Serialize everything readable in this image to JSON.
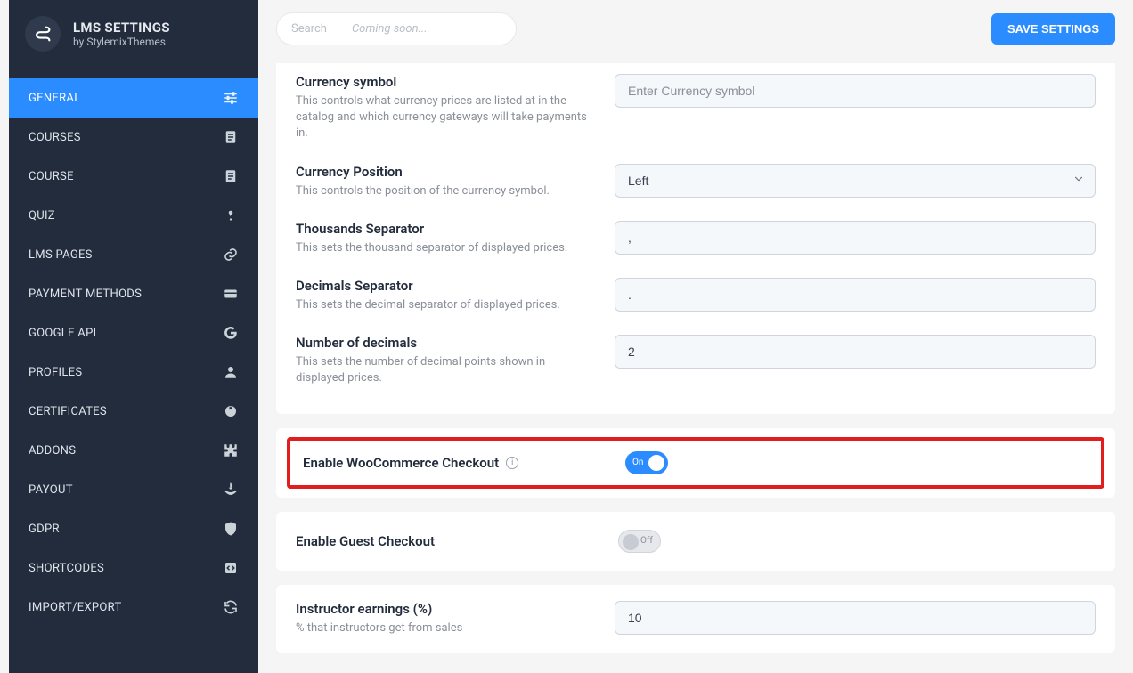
{
  "app": {
    "title": "LMS SETTINGS",
    "subtitle": "by StylemixThemes"
  },
  "sidebar": {
    "items": [
      {
        "label": "GENERAL",
        "icon": "sliders-icon",
        "active": true
      },
      {
        "label": "COURSES",
        "icon": "doc-icon"
      },
      {
        "label": "COURSE",
        "icon": "doc-icon"
      },
      {
        "label": "QUIZ",
        "icon": "question-icon"
      },
      {
        "label": "LMS PAGES",
        "icon": "link-icon"
      },
      {
        "label": "PAYMENT METHODS",
        "icon": "card-icon"
      },
      {
        "label": "GOOGLE API",
        "icon": "google-icon"
      },
      {
        "label": "PROFILES",
        "icon": "user-icon"
      },
      {
        "label": "CERTIFICATES",
        "icon": "badge-icon"
      },
      {
        "label": "ADDONS",
        "icon": "puzzle-icon"
      },
      {
        "label": "PAYOUT",
        "icon": "payout-icon"
      },
      {
        "label": "GDPR",
        "icon": "shield-icon"
      },
      {
        "label": "SHORTCODES",
        "icon": "code-icon"
      },
      {
        "label": "IMPORT/EXPORT",
        "icon": "refresh-icon"
      }
    ]
  },
  "topbar": {
    "search_label": "Search",
    "search_placeholder": "Coming soon...",
    "save_button": "SAVE SETTINGS"
  },
  "settings": {
    "currency_symbol": {
      "title": "Currency symbol",
      "desc": "This controls what currency prices are listed at in the catalog and which currency gateways will take payments in.",
      "placeholder": "Enter Currency symbol",
      "value": ""
    },
    "currency_position": {
      "title": "Currency Position",
      "desc": "This controls the position of the currency symbol.",
      "value": "Left"
    },
    "thousands_separator": {
      "title": "Thousands Separator",
      "desc": "This sets the thousand separator of displayed prices.",
      "value": ","
    },
    "decimals_separator": {
      "title": "Decimals Separator",
      "desc": "This sets the decimal separator of displayed prices.",
      "value": "."
    },
    "number_of_decimals": {
      "title": "Number of decimals",
      "desc": "This sets the number of decimal points shown in displayed prices.",
      "value": "2"
    },
    "enable_woo": {
      "title": "Enable WooCommerce Checkout",
      "state_label": "On",
      "on": true
    },
    "enable_guest": {
      "title": "Enable Guest Checkout",
      "state_label": "Off",
      "on": false
    },
    "instructor_earnings": {
      "title": "Instructor earnings (%)",
      "desc": "% that instructors get from sales",
      "value": "10"
    }
  }
}
